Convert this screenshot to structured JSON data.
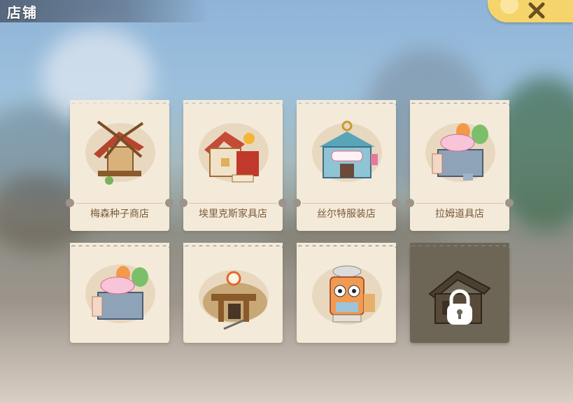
{
  "header": {
    "title": "店铺",
    "close_icon": "close-icon"
  },
  "shops": [
    {
      "name": "梅森种子商店",
      "icon": "windmill-seed-shop-icon",
      "locked": false
    },
    {
      "name": "埃里克斯家具店",
      "icon": "furniture-shop-icon",
      "locked": false
    },
    {
      "name": "丝尔特服装店",
      "icon": "clothing-shop-icon",
      "locked": false
    },
    {
      "name": "拉姆道具店",
      "icon": "item-shop-icon",
      "locked": false
    },
    {
      "name": "",
      "icon": "item-shop-icon",
      "locked": false
    },
    {
      "name": "",
      "icon": "mine-shop-icon",
      "locked": false
    },
    {
      "name": "",
      "icon": "robot-shop-icon",
      "locked": false
    },
    {
      "name": "",
      "icon": "lock-icon",
      "locked": true
    }
  ],
  "colors": {
    "card": "#f4ead9",
    "label": "#7a5a3a",
    "close_tab": "#f5d46b",
    "locked": "#6d6656"
  }
}
